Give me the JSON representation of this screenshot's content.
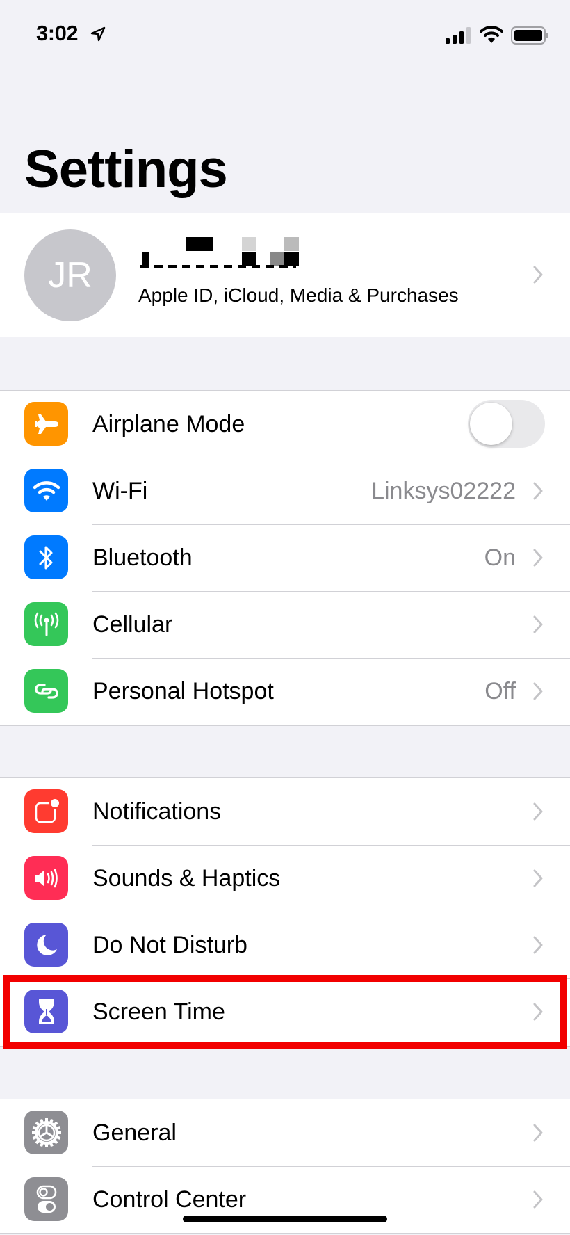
{
  "status_bar": {
    "time": "3:02",
    "icons": [
      "location-arrow-icon",
      "cellular-signal-icon",
      "wifi-icon",
      "battery-icon"
    ]
  },
  "header": {
    "title": "Settings"
  },
  "profile": {
    "initials": "JR",
    "subtitle": "Apple ID, iCloud, Media & Purchases"
  },
  "groups": [
    {
      "items": [
        {
          "label": "Airplane Mode",
          "icon": "airplane-icon",
          "color": "#FF9500",
          "control": "toggle",
          "toggle_on": false
        },
        {
          "label": "Wi-Fi",
          "icon": "wifi-icon",
          "color": "#007AFF",
          "value": "Linksys02222"
        },
        {
          "label": "Bluetooth",
          "icon": "bluetooth-icon",
          "color": "#007AFF",
          "value": "On"
        },
        {
          "label": "Cellular",
          "icon": "cellular-antenna-icon",
          "color": "#34C759"
        },
        {
          "label": "Personal Hotspot",
          "icon": "hotspot-icon",
          "color": "#34C759",
          "value": "Off"
        }
      ]
    },
    {
      "items": [
        {
          "label": "Notifications",
          "icon": "notifications-icon",
          "color": "#FF3B30"
        },
        {
          "label": "Sounds & Haptics",
          "icon": "speaker-icon",
          "color": "#FF2D55"
        },
        {
          "label": "Do Not Disturb",
          "icon": "moon-icon",
          "color": "#5856D6"
        },
        {
          "label": "Screen Time",
          "icon": "hourglass-icon",
          "color": "#5856D6",
          "highlighted": true
        }
      ]
    },
    {
      "items": [
        {
          "label": "General",
          "icon": "gear-icon",
          "color": "#8E8E93"
        },
        {
          "label": "Control Center",
          "icon": "control-center-icon",
          "color": "#8E8E93"
        }
      ]
    }
  ],
  "annotation": {
    "highlight_color": "#F20000",
    "highlight_target": "Screen Time"
  }
}
